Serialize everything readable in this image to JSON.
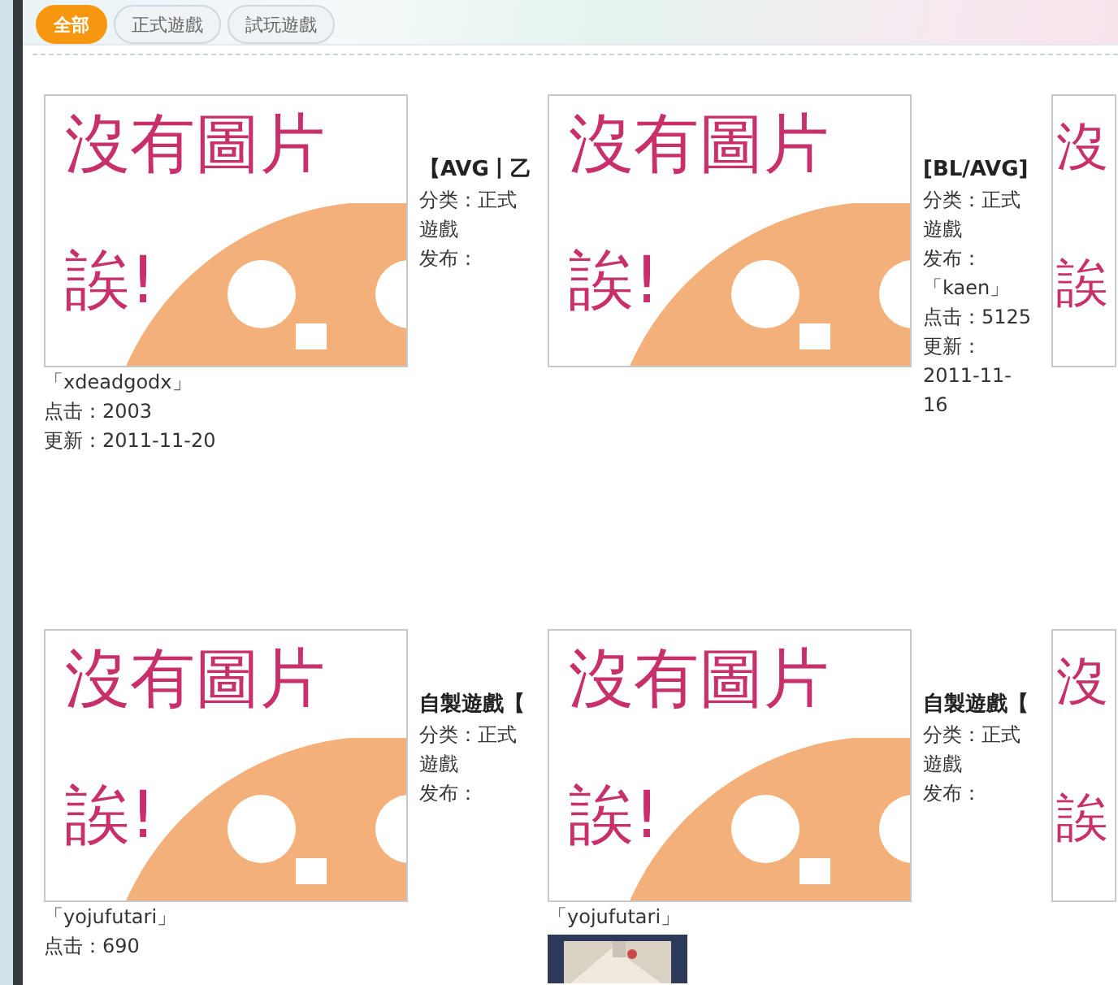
{
  "filters": [
    {
      "label": "全部",
      "selected": true
    },
    {
      "label": "正式遊戲",
      "selected": false
    },
    {
      "label": "試玩遊戲",
      "selected": false
    }
  ],
  "cards": [
    {
      "kind": "full",
      "image": {
        "line1": "沒有圖片",
        "line2": "誒!"
      },
      "title": "【AVG丨乙",
      "side": [
        "分类：正式遊戲",
        "发布："
      ],
      "below": [
        "「xdeadgodx」",
        "点击：2003",
        "更新：2011-11-20"
      ]
    },
    {
      "kind": "full",
      "image": {
        "line1": "沒有圖片",
        "line2": "誒!"
      },
      "title": "[BL/AVG]",
      "side": [
        "分类：正式遊戲",
        "发布：「kaen」",
        "点击：5125",
        "更新：2011-11-16"
      ]
    },
    {
      "kind": "edge",
      "image": {
        "line1": "沒",
        "line2": "誒"
      }
    },
    {
      "kind": "full",
      "image": {
        "line1": "沒有圖片",
        "line2": "誒!"
      },
      "title": "自製遊戲【",
      "side": [
        "分类：正式遊戲",
        "发布："
      ],
      "below": [
        "「yojufutari」",
        "点击：690"
      ]
    },
    {
      "kind": "covered",
      "image": {
        "line1": "沒有圖片",
        "line2": "誒!"
      },
      "title": "自製遊戲【",
      "side": [
        "分类：正式遊戲",
        "发布："
      ],
      "below": [
        "「yojufutari」"
      ]
    },
    {
      "kind": "edge",
      "image": {
        "line1": "沒",
        "line2": "誒"
      }
    }
  ]
}
